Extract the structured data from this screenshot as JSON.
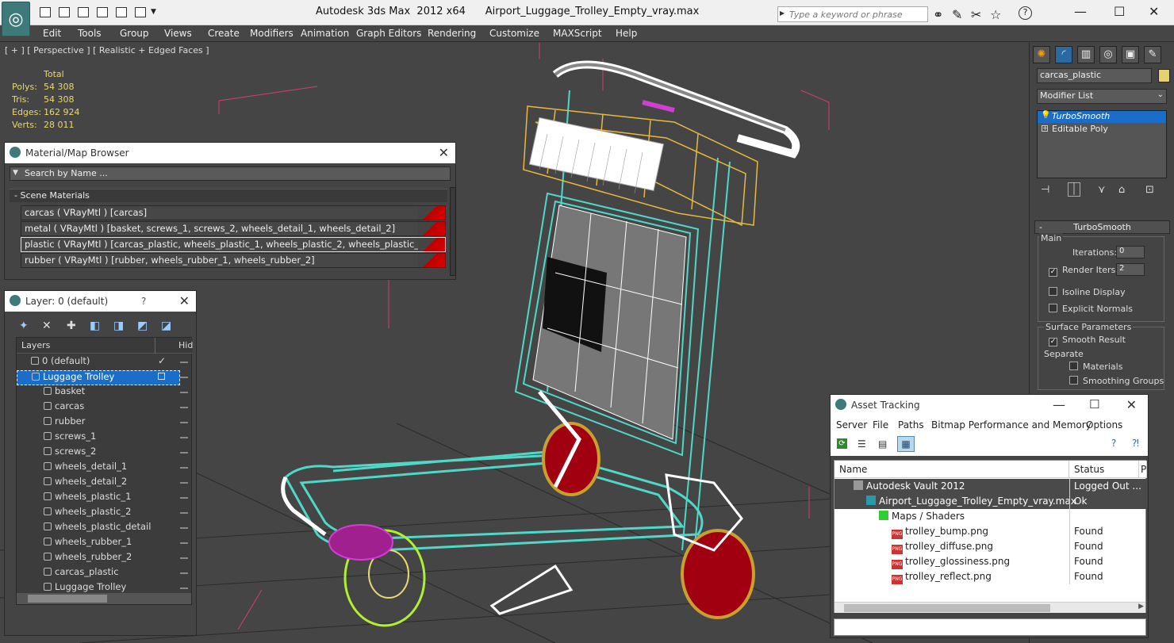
{
  "window": {
    "title_app": "Autodesk 3ds Max  2012 x64",
    "title_file": "Airport_Luggage_Trolley_Empty_vray.max",
    "search_placeholder": "Type a keyword or phrase"
  },
  "menu": [
    "Edit",
    "Tools",
    "Group",
    "Views",
    "Create",
    "Modifiers",
    "Animation",
    "Graph Editors",
    "Rendering",
    "Customize",
    "MAXScript",
    "Help"
  ],
  "viewport": {
    "label": "[ + ] [ Perspective ] [ Realistic + Edged Faces ]",
    "stats": {
      "header": "Total",
      "polys_label": "Polys:",
      "polys": "54 308",
      "tris_label": "Tris:",
      "tris": "54 308",
      "edges_label": "Edges:",
      "edges": "162 924",
      "verts_label": "Verts:",
      "verts": "28 011"
    }
  },
  "material_browser": {
    "title": "Material/Map Browser",
    "search": "Search by Name ...",
    "section": "- Scene Materials",
    "rows": [
      "carcas  ( VRayMtl ) [carcas]",
      "metal  ( VRayMtl ) [basket, screws_1, screws_2, wheels_detail_1, wheels_detail_2]",
      "plastic ( VRayMtl ) [carcas_plastic, wheels_plastic_1, wheels_plastic_2, wheels_plastic_detail]",
      "rubber  ( VRayMtl ) [rubber, wheels_rubber_1, wheels_rubber_2]"
    ]
  },
  "layer_dialog": {
    "title": "Layer: 0 (default)",
    "help": "?",
    "col_layers": "Layers",
    "col_hide": "Hid",
    "rows": [
      {
        "label": "0 (default)",
        "indent": 1
      },
      {
        "label": "Luggage Trolley",
        "indent": 1
      },
      {
        "label": "basket",
        "indent": 2
      },
      {
        "label": "carcas",
        "indent": 2
      },
      {
        "label": "rubber",
        "indent": 2
      },
      {
        "label": "screws_1",
        "indent": 2
      },
      {
        "label": "screws_2",
        "indent": 2
      },
      {
        "label": "wheels_detail_1",
        "indent": 2
      },
      {
        "label": "wheels_detail_2",
        "indent": 2
      },
      {
        "label": "wheels_plastic_1",
        "indent": 2
      },
      {
        "label": "wheels_plastic_2",
        "indent": 2
      },
      {
        "label": "wheels_plastic_detail",
        "indent": 2
      },
      {
        "label": "wheels_rubber_1",
        "indent": 2
      },
      {
        "label": "wheels_rubber_2",
        "indent": 2
      },
      {
        "label": "carcas_plastic",
        "indent": 2
      },
      {
        "label": "Luggage Trolley",
        "indent": 2
      }
    ]
  },
  "command_panel": {
    "object_name": "carcas_plastic",
    "modifier_list": "Modifier List",
    "stack": [
      "TurboSmooth",
      "Editable Poly"
    ],
    "rollout_title": "TurboSmooth",
    "main_label": "Main",
    "iterations_label": "Iterations:",
    "iterations": "0",
    "render_iters_label": "Render Iters:",
    "render_iters": "2",
    "isoline": "Isoline Display",
    "explicit_normals": "Explicit Normals",
    "surface_params": "Surface Parameters",
    "smooth_result": "Smooth Result",
    "separate": "Separate",
    "materials": "Materials",
    "smoothing_groups": "Smoothing Groups"
  },
  "asset_tracking": {
    "title": "Asset Tracking",
    "menu": [
      "Server",
      "File",
      "Paths",
      "Bitmap Performance and Memory",
      "Options"
    ],
    "col_name": "Name",
    "col_status": "Status",
    "col_extra": "P",
    "rows": [
      {
        "name": "Autodesk Vault 2012",
        "status": "Logged Out ...",
        "indent": 0
      },
      {
        "name": "Airport_Luggage_Trolley_Empty_vray.max",
        "status": "Ok",
        "indent": 1
      },
      {
        "name": "Maps / Shaders",
        "status": "",
        "indent": 2
      },
      {
        "name": "trolley_bump.png",
        "status": "Found",
        "indent": 3
      },
      {
        "name": "trolley_diffuse.png",
        "status": "Found",
        "indent": 3
      },
      {
        "name": "trolley_glossiness.png",
        "status": "Found",
        "indent": 3
      },
      {
        "name": "trolley_reflect.png",
        "status": "Found",
        "indent": 3
      }
    ]
  }
}
